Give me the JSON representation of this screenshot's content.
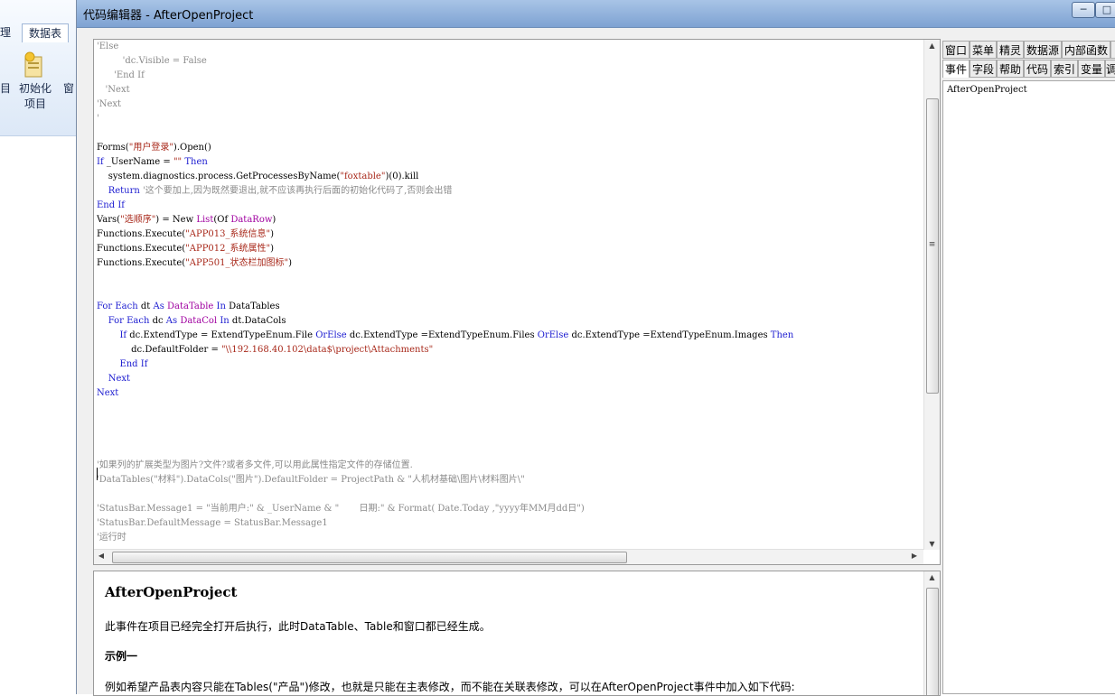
{
  "background_app": {
    "tabs": [
      "理",
      "数据表"
    ],
    "button_left_label": "目",
    "button_main_label": [
      "初始化",
      "项目"
    ],
    "button_right_label": "窗"
  },
  "window": {
    "title": "代码编辑器 - AfterOpenProject",
    "controls": [
      "─",
      "□"
    ]
  },
  "side_panel": {
    "tabs_row1": [
      "窗口",
      "菜单",
      "精灵",
      "数据源",
      "内部函数",
      ""
    ],
    "tabs_row2": [
      "事件",
      "字段",
      "帮助",
      "代码",
      "索引",
      "变量",
      "调"
    ],
    "active_tab": "事件",
    "list": [
      "AfterOpenProject"
    ]
  },
  "editor": {
    "lines": [
      [
        [
          "cmt",
          "'Else"
        ]
      ],
      [
        [
          "cmt",
          "         'dc.Visible = False"
        ]
      ],
      [
        [
          "cmt",
          "      'End If"
        ]
      ],
      [
        [
          "cmt",
          "   'Next"
        ]
      ],
      [
        [
          "cmt",
          "'Next"
        ]
      ],
      [
        [
          "cmt",
          "'"
        ]
      ],
      [],
      [
        [
          "txt",
          "Forms("
        ],
        [
          "str",
          "\"用户登录\""
        ],
        [
          "txt",
          ").Open()"
        ]
      ],
      [
        [
          "kw",
          "If"
        ],
        [
          "txt",
          " _UserName = "
        ],
        [
          "str",
          "\"\""
        ],
        [
          "txt",
          " "
        ],
        [
          "kw",
          "Then"
        ]
      ],
      [
        [
          "txt",
          "    system.diagnostics.process.GetProcessesByName("
        ],
        [
          "str",
          "\"foxtable\""
        ],
        [
          "txt",
          ")(0).kill"
        ]
      ],
      [
        [
          "txt",
          "    "
        ],
        [
          "kw",
          "Return"
        ],
        [
          "txt",
          " "
        ],
        [
          "cmt",
          "'这个要加上,因为既然要退出,就不应该再执行后面的初始化代码了,否则会出错"
        ]
      ],
      [
        [
          "kw",
          "End If"
        ]
      ],
      [
        [
          "txt",
          "Vars("
        ],
        [
          "str",
          "\"选顺序\""
        ],
        [
          "txt",
          ") = New "
        ],
        [
          "type",
          "List"
        ],
        [
          "txt",
          "(Of "
        ],
        [
          "type",
          "DataRow"
        ],
        [
          "txt",
          ")"
        ]
      ],
      [
        [
          "txt",
          "Functions.Execute("
        ],
        [
          "str",
          "\"APP013_系统信息\""
        ],
        [
          "txt",
          ")"
        ]
      ],
      [
        [
          "txt",
          "Functions.Execute("
        ],
        [
          "str",
          "\"APP012_系统属性\""
        ],
        [
          "txt",
          ")"
        ]
      ],
      [
        [
          "txt",
          "Functions.Execute("
        ],
        [
          "str",
          "\"APP501_状态栏加图标\""
        ],
        [
          "txt",
          ")"
        ]
      ],
      [],
      [],
      [
        [
          "kw",
          "For Each"
        ],
        [
          "txt",
          " dt "
        ],
        [
          "kw",
          "As"
        ],
        [
          "txt",
          " "
        ],
        [
          "type",
          "DataTable"
        ],
        [
          "txt",
          " "
        ],
        [
          "kw",
          "In"
        ],
        [
          "txt",
          " DataTables"
        ]
      ],
      [
        [
          "txt",
          "    "
        ],
        [
          "kw",
          "For Each"
        ],
        [
          "txt",
          " dc "
        ],
        [
          "kw",
          "As"
        ],
        [
          "txt",
          " "
        ],
        [
          "type",
          "DataCol"
        ],
        [
          "txt",
          " "
        ],
        [
          "kw",
          "In"
        ],
        [
          "txt",
          " dt.DataCols"
        ]
      ],
      [
        [
          "txt",
          "        "
        ],
        [
          "kw",
          "If"
        ],
        [
          "txt",
          " dc.ExtendType = ExtendTypeEnum.File "
        ],
        [
          "kw",
          "OrElse"
        ],
        [
          "txt",
          " dc.ExtendType =ExtendTypeEnum.Files "
        ],
        [
          "kw",
          "OrElse"
        ],
        [
          "txt",
          " dc.ExtendType =ExtendTypeEnum.Images "
        ],
        [
          "kw",
          "Then"
        ]
      ],
      [
        [
          "txt",
          "            dc.DefaultFolder = "
        ],
        [
          "str",
          "\"\\\\192.168.40.102\\data$\\project\\Attachments\""
        ]
      ],
      [
        [
          "txt",
          "        "
        ],
        [
          "kw",
          "End If"
        ]
      ],
      [
        [
          "txt",
          "    "
        ],
        [
          "kw",
          "Next"
        ]
      ],
      [
        [
          "kw",
          "Next"
        ]
      ],
      [],
      [],
      [],
      [],
      [
        [
          "cmt",
          "'如果列的扩展类型为图片?文件?或者多文件,可以用此属性指定文件的存储位置."
        ]
      ],
      [
        [
          "cmt",
          "'DataTables(\"材料\").DataCols(\"图片\").DefaultFolder = ProjectPath & \"人机材基础\\图片\\材料图片\\\""
        ]
      ],
      [],
      [
        [
          "cmt",
          "'StatusBar.Message1 = \"当前用户:\" & _UserName & \"       日期:\" & Format( Date.Today ,\"yyyy年MM月dd日\")"
        ]
      ],
      [
        [
          "cmt",
          "'StatusBar.DefaultMessage = StatusBar.Message1"
        ]
      ],
      [
        [
          "cmt",
          "'运行时"
        ]
      ]
    ]
  },
  "help": {
    "title": "AfterOpenProject",
    "paragraphs": [
      "此事件在项目已经完全打开后执行，此时DataTable、Table和窗口都已经生成。",
      "示例一",
      "例如希望产品表内容只能在Tables(\"产品\")修改，也就是只能在主表修改，而不能在关联表修改，可以在AfterOpenProject事件中加入如下代码:"
    ]
  }
}
